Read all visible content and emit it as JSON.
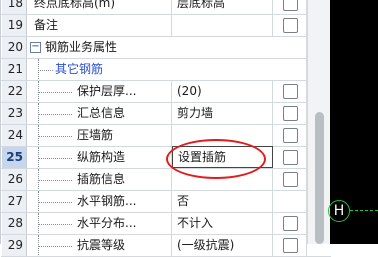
{
  "rows": [
    {
      "num": "18",
      "name": "终点底标高(m)",
      "value": "层底标高",
      "checkbox": true
    },
    {
      "num": "19",
      "name": "备注",
      "value": "",
      "checkbox": true
    },
    {
      "num": "20",
      "name": "钢筋业务属性",
      "value": "",
      "checkbox": false,
      "expander": "−"
    },
    {
      "num": "21",
      "name": "其它钢筋",
      "value": "",
      "checkbox": false
    },
    {
      "num": "22",
      "name": "保护层厚...",
      "value": "(20)",
      "checkbox": true
    },
    {
      "num": "23",
      "name": "汇总信息",
      "value": "剪力墙",
      "checkbox": true
    },
    {
      "num": "24",
      "name": "压墙筋",
      "value": "",
      "checkbox": true
    },
    {
      "num": "25",
      "name": "纵筋构造",
      "value": "设置插筋",
      "checkbox": true
    },
    {
      "num": "26",
      "name": "插筋信息",
      "value": "",
      "checkbox": true
    },
    {
      "num": "27",
      "name": "水平钢筋...",
      "value": "否",
      "checkbox": false
    },
    {
      "num": "28",
      "name": "水平分布...",
      "value": "不计入",
      "checkbox": true
    },
    {
      "num": "29",
      "name": "抗震等级",
      "value": "(一级抗震)",
      "checkbox": true
    }
  ],
  "canvas": {
    "marker_label": "H"
  },
  "colors": {
    "highlight": "#e21b1b",
    "canvas_bg": "#000000",
    "cad_green": "#27c23a",
    "link_blue": "#2a4fd6"
  }
}
